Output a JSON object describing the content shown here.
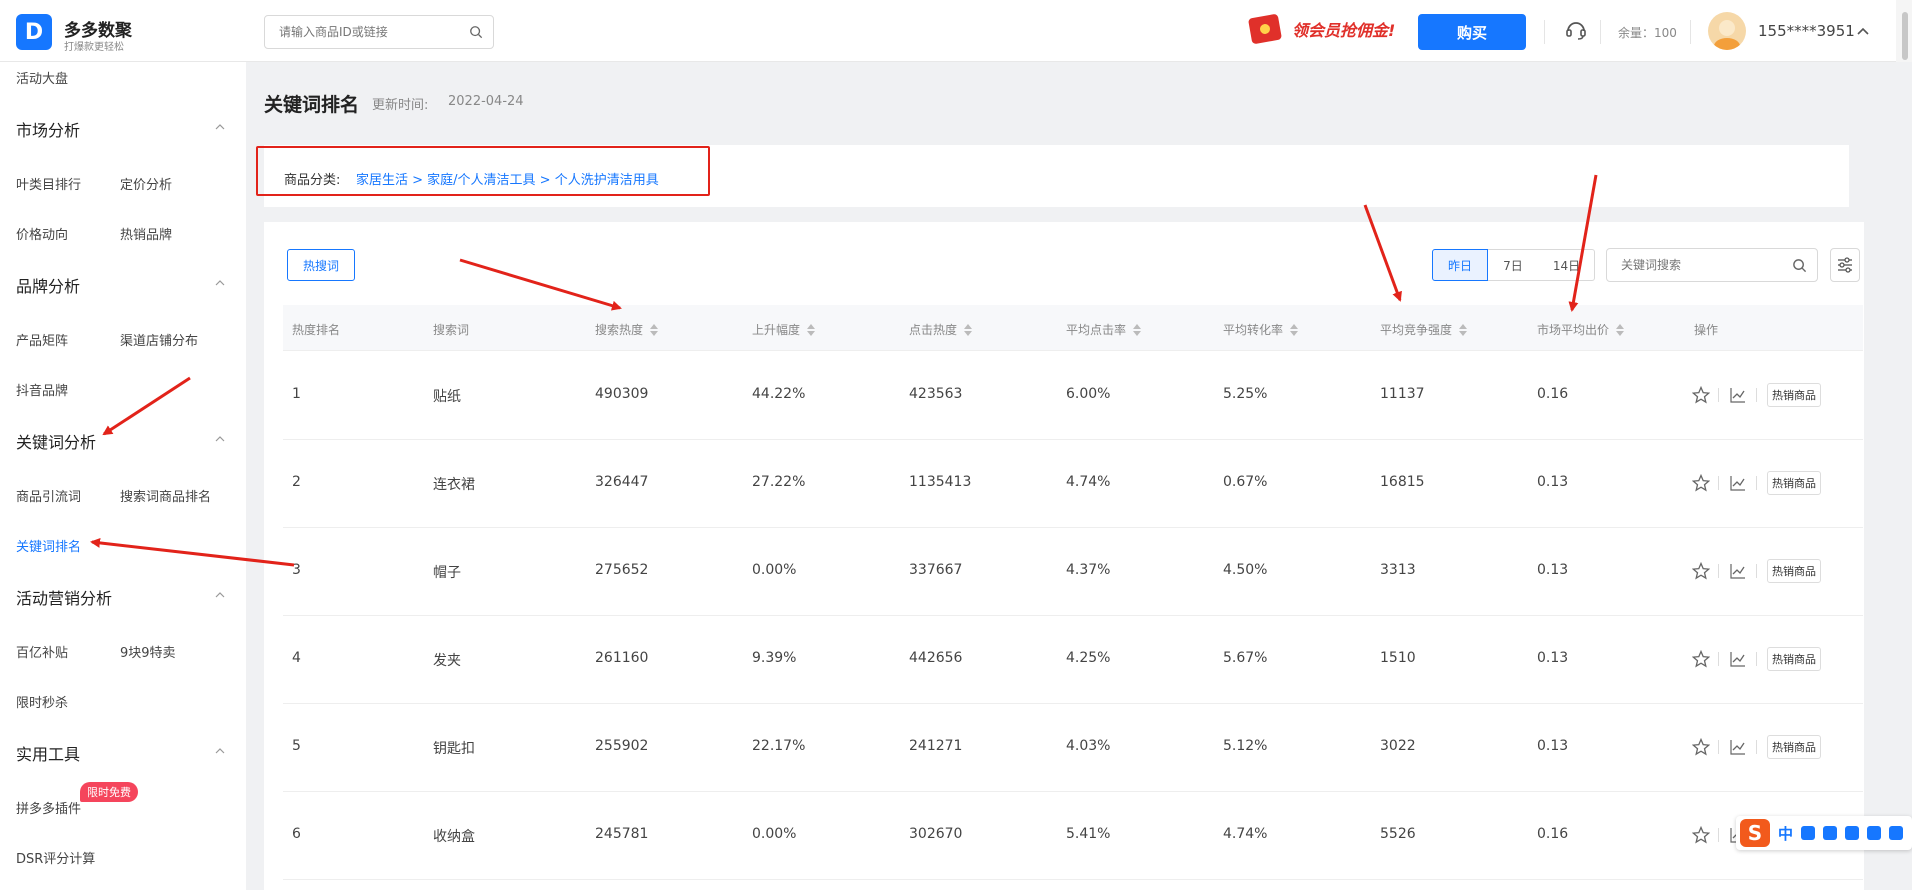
{
  "header": {
    "brand_name": "多多数聚",
    "brand_slogan": "打爆款更轻松",
    "search_placeholder": "请输入商品ID或链接",
    "promo_text": "领会员抢佣金!",
    "buy_label": "购买",
    "balance": "余量：100",
    "username": "155****3951"
  },
  "sidebar": {
    "top_item": "活动大盘",
    "groups": {
      "market": "市场分析",
      "brand": "品牌分析",
      "keyword": "关键词分析",
      "activity": "活动营销分析",
      "tools": "实用工具"
    },
    "items": {
      "leaf_category_rank": "叶类目排行",
      "pricing_analysis": "定价分析",
      "price_trend": "价格动向",
      "hot_brands": "热销品牌",
      "product_matrix": "产品矩阵",
      "channel_store": "渠道店铺分布",
      "douyin_brand": "抖音品牌",
      "traffic_words": "商品引流词",
      "search_product_rank": "搜索词商品排名",
      "keyword_rank": "关键词排名",
      "subsidy": "百亿补贴",
      "nine_nine": "9块9特卖",
      "flash_sale": "限时秒杀",
      "pdd_plugin": "拼多多插件",
      "dsr_calc": "DSR评分计算"
    },
    "free_badge": "限时免费"
  },
  "main": {
    "title": "关键词排名",
    "update_label": "更新时间:",
    "update_value": "2022-04-24",
    "category_label": "商品分类:",
    "category_path": "家居生活 > 家庭/个人清洁工具 > 个人洗护清洁用具",
    "hot_words_button": "热搜词",
    "periods": [
      "昨日",
      "7日",
      "14日"
    ],
    "keyword_search_placeholder": "关键词搜索",
    "columns": [
      "热度排名",
      "搜索词",
      "搜索热度",
      "上升幅度",
      "点击热度",
      "平均点击率",
      "平均转化率",
      "平均竞争强度",
      "市场平均出价",
      "操作"
    ],
    "action_button": "热销商品",
    "rows": [
      [
        "1",
        "贴纸",
        "490309",
        "44.22%",
        "423563",
        "6.00%",
        "5.25%",
        "11137",
        "0.16"
      ],
      [
        "2",
        "连衣裙",
        "326447",
        "27.22%",
        "1135413",
        "4.74%",
        "0.67%",
        "16815",
        "0.13"
      ],
      [
        "3",
        "帽子",
        "275652",
        "0.00%",
        "337667",
        "4.37%",
        "4.50%",
        "3313",
        "0.13"
      ],
      [
        "4",
        "发夹",
        "261160",
        "9.39%",
        "442656",
        "4.25%",
        "5.67%",
        "1510",
        "0.13"
      ],
      [
        "5",
        "钥匙扣",
        "255902",
        "22.17%",
        "241271",
        "4.03%",
        "5.12%",
        "3022",
        "0.13"
      ],
      [
        "6",
        "收纳盒",
        "245781",
        "0.00%",
        "302670",
        "5.41%",
        "4.74%",
        "5526",
        "0.16"
      ]
    ]
  },
  "ime": {
    "logo": "S",
    "lang": "中"
  },
  "colors": {
    "accent": "#1677ff",
    "annotation_red": "#e2231a"
  }
}
